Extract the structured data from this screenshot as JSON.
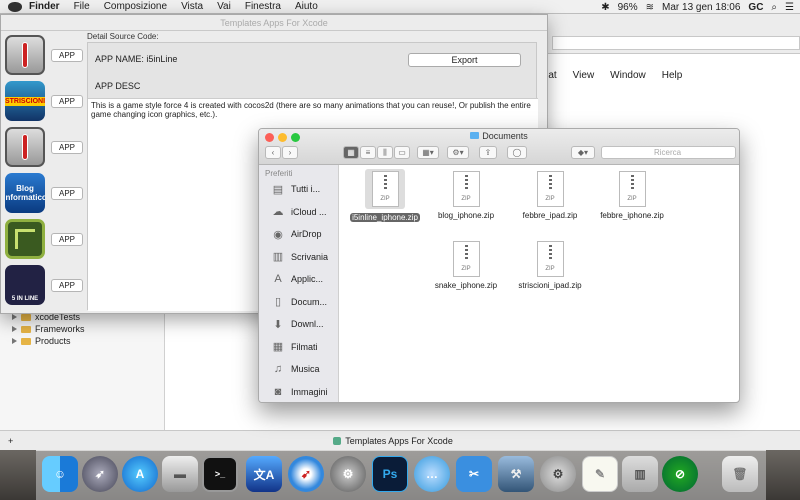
{
  "menubar": {
    "app": "Finder",
    "items": [
      "File",
      "Composizione",
      "Vista",
      "Vai",
      "Finestra",
      "Aiuto"
    ],
    "battery": "96%",
    "datetime": "Mar 13 gen  18:06",
    "user": "GC"
  },
  "xcode": {
    "menu_items": [
      "mat",
      "View",
      "Window",
      "Help"
    ],
    "tree": [
      "xcodeTests",
      "Frameworks",
      "Products"
    ],
    "status": "Templates Apps For Xcode"
  },
  "template": {
    "title": "Templates Apps For Xcode",
    "section_label": "Detail Source Code:",
    "app_name_label": "APP NAME:",
    "app_name_value": "i5inLine",
    "export_label": "Export",
    "app_desc_label": "APP DESC",
    "description": "This is a game style force 4 is created with cocos2d (there are so many animations that you can reuse!, Or publish the entire game changing icon graphics, etc.).",
    "app_button_label": "APP",
    "apps": [
      {
        "name": "febbre",
        "icon_text": ""
      },
      {
        "name": "striscioni",
        "icon_text": "STRISCIONI"
      },
      {
        "name": "febbre-ipad",
        "icon_text": ""
      },
      {
        "name": "blog",
        "icon_text": "Blog Informatico"
      },
      {
        "name": "snake",
        "icon_text": ""
      },
      {
        "name": "5inline",
        "icon_text": "5 IN LINE"
      }
    ]
  },
  "finder": {
    "title": "Documents",
    "search_placeholder": "Ricerca",
    "sidebar_header": "Preferiti",
    "sidebar": [
      "Tutti i...",
      "iCloud ...",
      "AirDrop",
      "Scrivania",
      "Applic...",
      "Docum...",
      "Downl...",
      "Filmati",
      "Musica",
      "Immagini"
    ],
    "file_type": "ZIP",
    "files": [
      "i5inline_iphone.zip",
      "blog_iphone.zip",
      "febbre_ipad.zip",
      "febbre_iphone.zip",
      "snake_iphone.zip",
      "striscioni_ipad.zip"
    ]
  },
  "dock": [
    "Finder",
    "Launchpad",
    "App Store",
    "Disk",
    "Terminal",
    "Translator",
    "Safari",
    "System Preferences",
    "Photoshop",
    "Messages",
    "Utilities",
    "Xcode",
    "Preferences",
    "TextEdit",
    "Archive",
    "Instruments",
    "Trash"
  ]
}
